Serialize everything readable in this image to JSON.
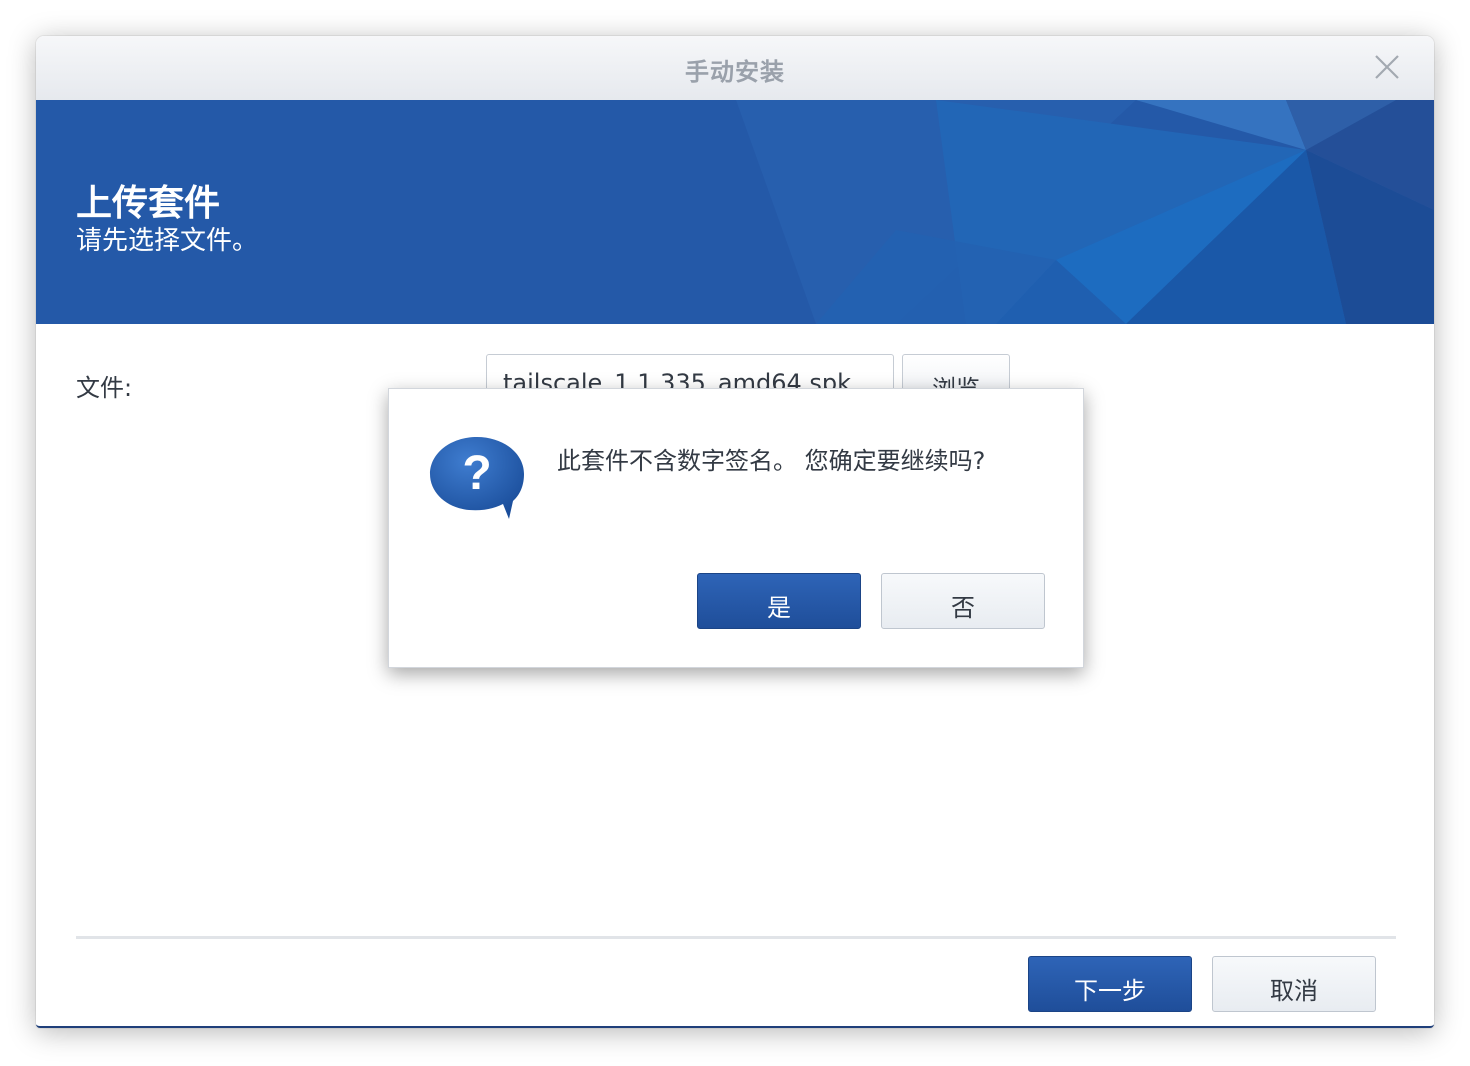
{
  "window": {
    "title": "手动安装"
  },
  "banner": {
    "heading": "上传套件",
    "subheading": "请先选择文件。"
  },
  "form": {
    "file_label": "文件:",
    "file_value": "tailscale_1.1.335_amd64.spk",
    "browse_label": "浏览"
  },
  "footer": {
    "next_label": "下一步",
    "cancel_label": "取消"
  },
  "dialog": {
    "icon": "question-bubble-icon",
    "message": "此套件不含数字签名。 您确定要继续吗?",
    "yes_label": "是",
    "no_label": "否"
  },
  "colors": {
    "banner": "#2459a8",
    "primary_button": "#1f4e9a",
    "title_text": "#9aa1ab"
  }
}
